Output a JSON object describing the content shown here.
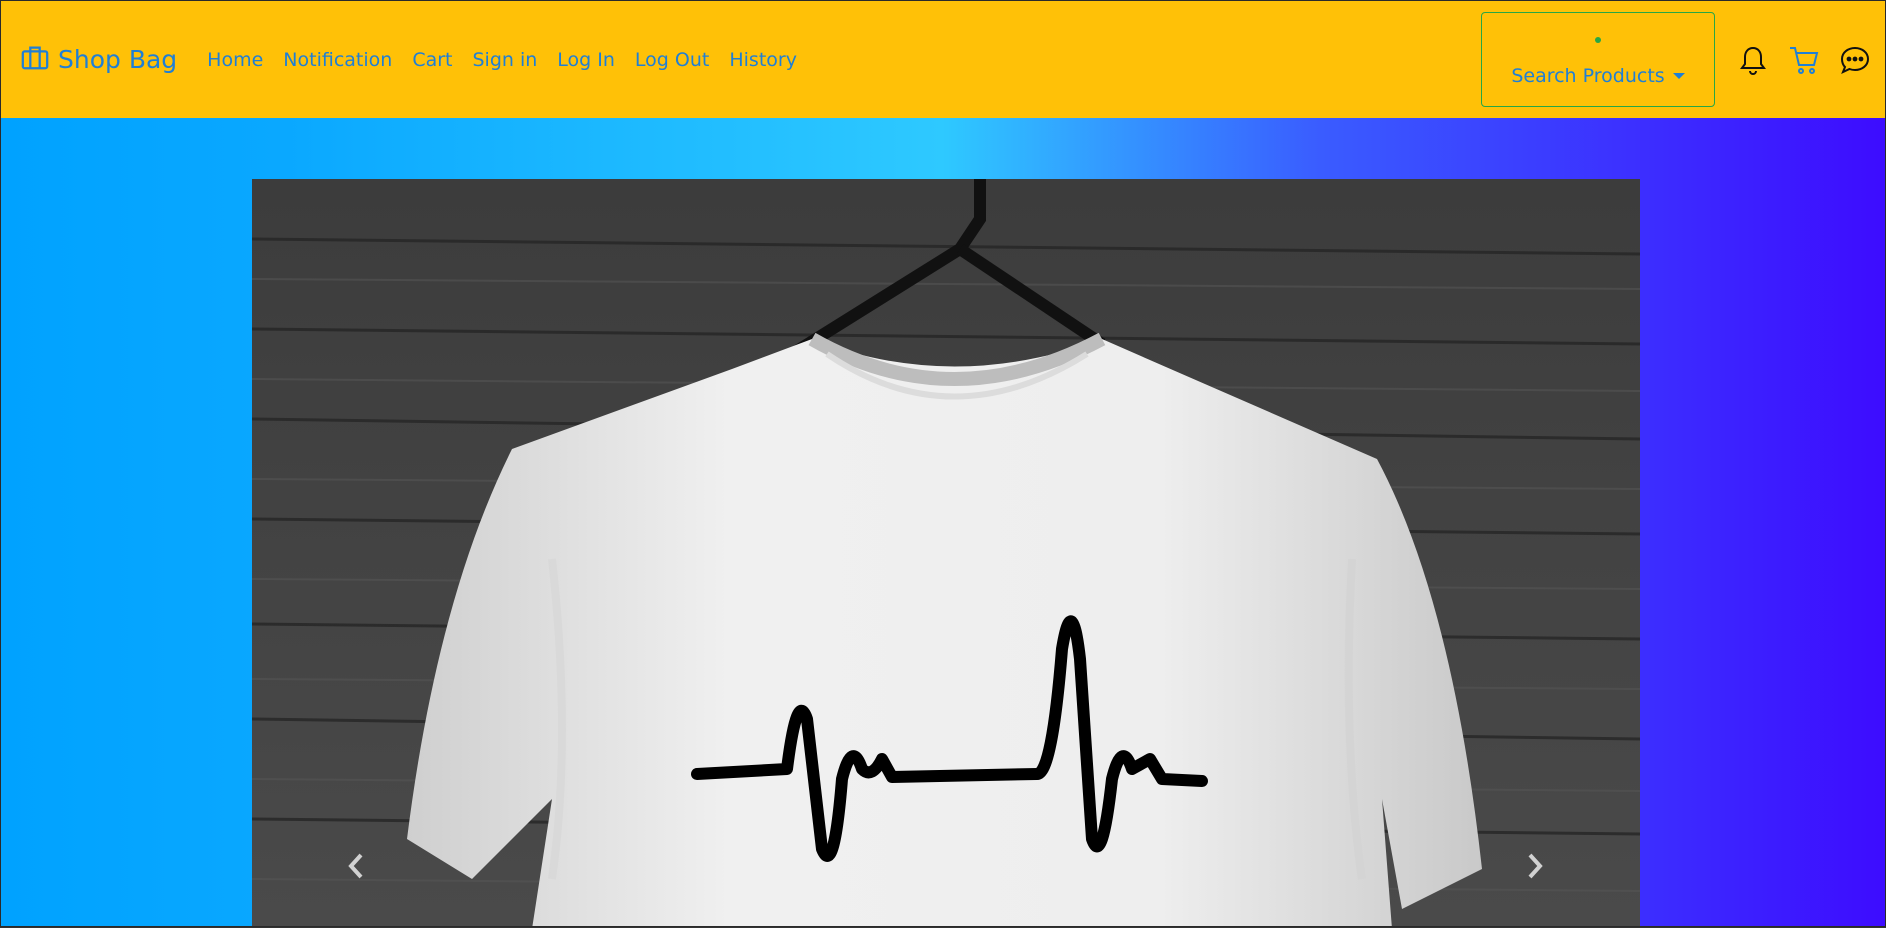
{
  "brand": {
    "name": "Shop Bag",
    "icon": "briefcase-icon"
  },
  "nav": {
    "links": [
      "Home",
      "Notification",
      "Cart",
      "Sign in",
      "Log In",
      "Log Out",
      "History"
    ]
  },
  "search": {
    "label": "Search Products"
  },
  "icons": {
    "notification": "bell-icon",
    "cart": "cart-icon",
    "chat": "chat-icon"
  },
  "carousel": {
    "slide_image": "white t-shirt with heartbeat line on hanger",
    "prev_icon": "chevron-left-icon",
    "next_icon": "chevron-right-icon"
  },
  "colors": {
    "navbar": "#ffc107",
    "link": "#1f7fd6",
    "search_border": "#28a745",
    "background_left": "#00a2ff",
    "background_right": "#3d0cff"
  }
}
